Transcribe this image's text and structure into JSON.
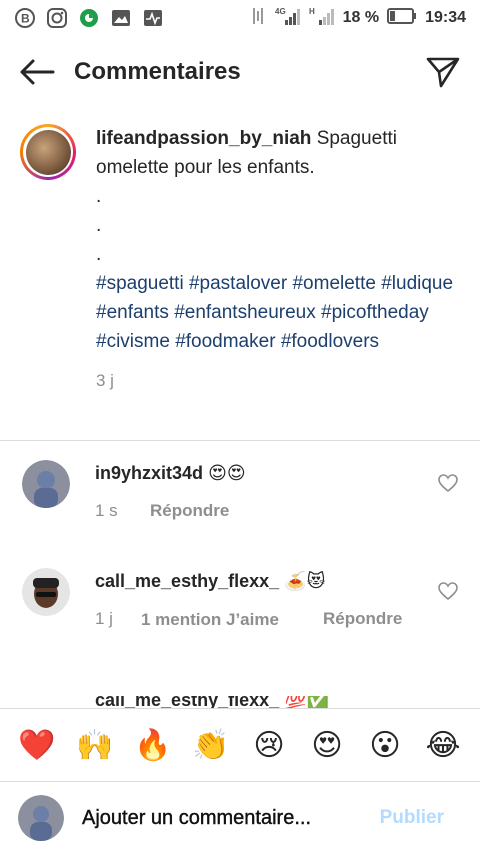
{
  "status_bar": {
    "battery_percent": "18 %",
    "time": "19:34",
    "network_1": "4G",
    "network_2": "H"
  },
  "header": {
    "title": "Commentaires"
  },
  "caption": {
    "username": "lifeandpassion_by_niah",
    "text": "Spaguetti omelette pour les enfants.",
    "dots": [
      ".",
      ".",
      "."
    ],
    "hashtags": [
      "#spaguetti",
      "#pastalover",
      "#omelette",
      "#ludique",
      "#enfants",
      "#enfantsheureux",
      "#picoftheday",
      "#civisme",
      "#foodmaker",
      "#foodlovers"
    ],
    "time": "3 j"
  },
  "comments": [
    {
      "username": "in9yhzxit34d",
      "emoji": "😍😍",
      "time": "1 s",
      "reply_label": "Répondre"
    },
    {
      "username": "call_me_esthy_flexx_",
      "emoji": "🍝😻",
      "time": "1 j",
      "likes": "1 mention J’aime",
      "reply_label": "Répondre"
    },
    {
      "username": "call_me_esthy_flexx_",
      "emoji": "💯✅"
    }
  ],
  "emoji_bar": [
    "❤️",
    "🙌",
    "🔥",
    "👏",
    "😢",
    "😍",
    "😮",
    "😂"
  ],
  "input": {
    "placeholder": "Ajouter un commentaire...",
    "publish_label": "Publier"
  },
  "colors": {
    "hashtag": "#1c3f6e",
    "publish": "#b3dbff",
    "heart_outline": "#8e8e8e"
  }
}
